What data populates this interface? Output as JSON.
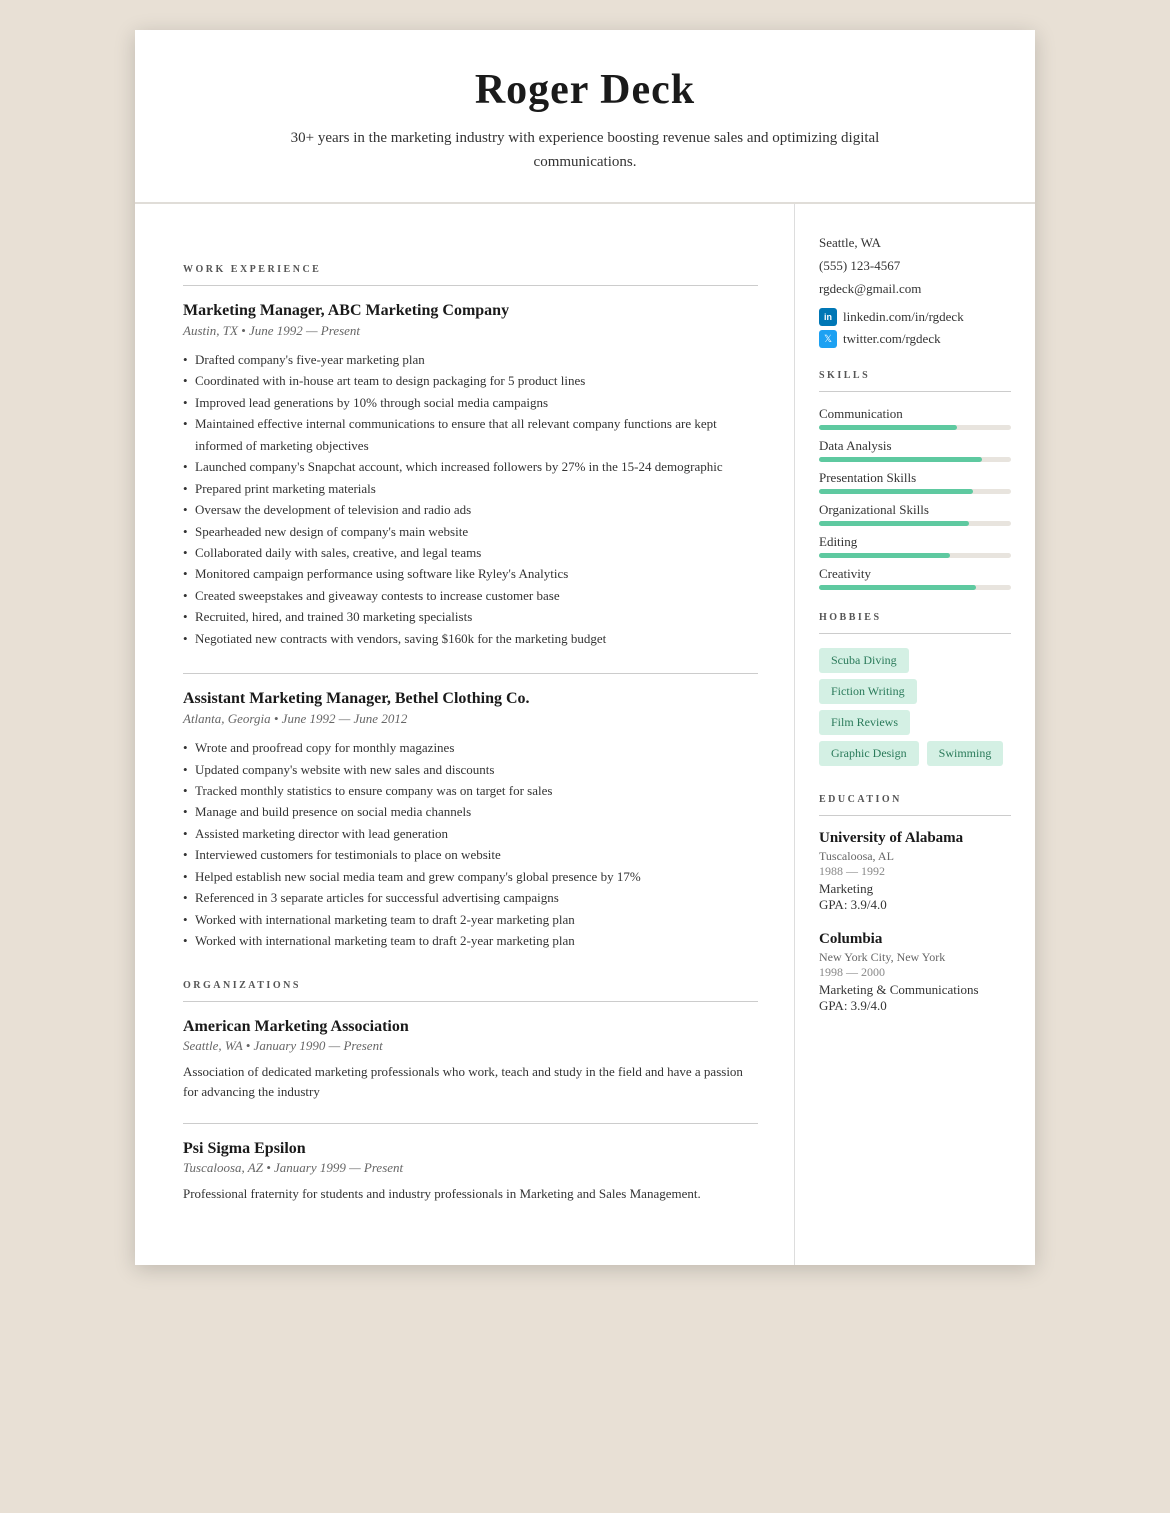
{
  "header": {
    "name": "Roger Deck",
    "tagline": "30+ years in the marketing industry with experience boosting revenue sales and optimizing digital communications."
  },
  "sidebar": {
    "contact": {
      "city": "Seattle, WA",
      "phone": "(555) 123-4567",
      "email": "rgdeck@gmail.com",
      "linkedin": "linkedin.com/in/rgdeck",
      "twitter": "twitter.com/rgdeck"
    },
    "skills_label": "SKILLS",
    "skills": [
      {
        "name": "Communication",
        "pct": 72
      },
      {
        "name": "Data Analysis",
        "pct": 85
      },
      {
        "name": "Presentation Skills",
        "pct": 80
      },
      {
        "name": "Organizational Skills",
        "pct": 78
      },
      {
        "name": "Editing",
        "pct": 68
      },
      {
        "name": "Creativity",
        "pct": 82
      }
    ],
    "hobbies_label": "HOBBIES",
    "hobbies": [
      "Scuba Diving",
      "Fiction Writing",
      "Film Reviews",
      "Graphic Design",
      "Swimming"
    ],
    "education_label": "EDUCATION",
    "education": [
      {
        "school": "University of Alabama",
        "location": "Tuscaloosa, AL",
        "dates": "1988 — 1992",
        "field": "Marketing",
        "gpa": "GPA: 3.9/4.0"
      },
      {
        "school": "Columbia",
        "location": "New York City, New York",
        "dates": "1998 — 2000",
        "field": "Marketing & Communications",
        "gpa": "GPA: 3.9/4.0"
      }
    ]
  },
  "main": {
    "work_label": "WORK EXPERIENCE",
    "jobs": [
      {
        "title": "Marketing Manager, ABC Marketing Company",
        "meta": "Austin, TX • June 1992 — Present",
        "bullets": [
          "Drafted company's five-year marketing plan",
          "Coordinated with in-house art team to design packaging for 5 product lines",
          "Improved lead generations by 10% through social media campaigns",
          "Maintained effective internal communications to ensure that all relevant company functions are kept informed of marketing objectives",
          "Launched company's Snapchat account, which increased followers by 27% in the 15-24 demographic",
          "Prepared print marketing materials",
          "Oversaw the development of television and radio ads",
          "Spearheaded new design of company's main website",
          "Collaborated daily with sales, creative, and legal teams",
          "Monitored campaign performance using software like Ryley's Analytics",
          "Created sweepstakes and giveaway contests to increase customer base",
          "Recruited, hired, and trained 30 marketing specialists",
          "Negotiated new contracts with vendors, saving $160k for the marketing budget"
        ]
      },
      {
        "title": "Assistant Marketing Manager, Bethel Clothing Co.",
        "meta": "Atlanta, Georgia • June 1992 — June 2012",
        "bullets": [
          "Wrote and proofread copy for monthly magazines",
          "Updated company's website with new sales and discounts",
          "Tracked monthly statistics to ensure company was on target for sales",
          "Manage and build presence on social media channels",
          "Assisted marketing director with lead generation",
          "Interviewed customers for testimonials to place on website",
          "Helped establish new social media team and grew company's global presence by 17%",
          "Referenced in 3 separate articles for successful advertising campaigns",
          "Worked with international marketing team to draft 2-year marketing plan",
          "Worked with international marketing team to draft 2-year marketing plan"
        ]
      }
    ],
    "orgs_label": "ORGANIZATIONS",
    "orgs": [
      {
        "name": "American Marketing Association",
        "meta": "Seattle, WA • January 1990 — Present",
        "desc": "Association of dedicated marketing professionals who work, teach and study in the field and have a passion for advancing the industry"
      },
      {
        "name": "Psi Sigma Epsilon",
        "meta": "Tuscaloosa, AZ • January 1999 — Present",
        "desc": "Professional fraternity for students and industry professionals in Marketing and Sales Management."
      }
    ]
  }
}
